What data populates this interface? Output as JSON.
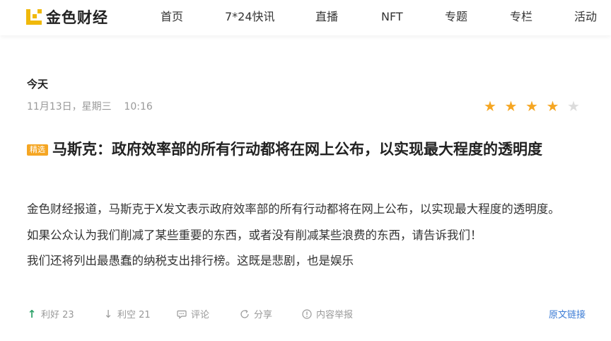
{
  "header": {
    "logo_text": "金色财经",
    "nav": [
      "首页",
      "7*24快讯",
      "直播",
      "NFT",
      "专题",
      "专栏",
      "活动"
    ]
  },
  "news": {
    "day_label": "今天",
    "datetime": "11月13日，星期三    10:16",
    "rating": {
      "value": 4,
      "max": 5,
      "on_color": "#f5a623",
      "off_color": "#dcdcdc"
    },
    "badge": "精选",
    "title": "马斯克：政府效率部的所有行动都将在网上公布，以实现最大程度的透明度",
    "paragraphs": [
      "金色财经报道，马斯克于X发文表示政府效率部的所有行动都将在网上公布，以实现最大程度的透明度。",
      "如果公众认为我们削减了某些重要的东西，或者没有削减某些浪费的东西，请告诉我们！",
      "我们还将列出最愚蠢的纳税支出排行榜。这既是悲剧，也是娱乐"
    ],
    "actions": {
      "bullish": "利好 23",
      "bearish": "利空 21",
      "comment": "评论",
      "share": "分享",
      "report": "内容举报",
      "source_link": "原文链接"
    }
  },
  "colors": {
    "brand": "#f0b90b",
    "link": "#3a7bd5",
    "bullish": "#2fa36b"
  }
}
